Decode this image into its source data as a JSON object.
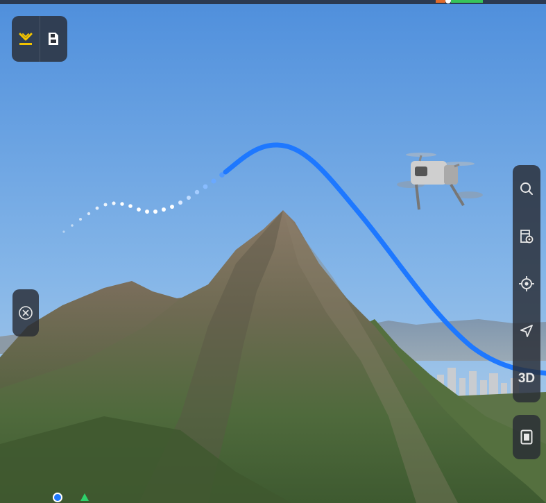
{
  "toolbar_top_left": {
    "items": [
      {
        "name": "landing-icon"
      },
      {
        "name": "save-icon"
      }
    ]
  },
  "left_panel": {
    "close_icon": "close-circle-icon"
  },
  "right_toolbar": {
    "items": [
      {
        "name": "search-icon"
      },
      {
        "name": "map-layers-icon"
      },
      {
        "name": "locate-target-icon"
      },
      {
        "name": "navigation-arrow-icon"
      },
      {
        "name": "3d-view-button",
        "label": "3D"
      }
    ],
    "extra_button": "map-view-icon"
  },
  "colors": {
    "accent": "#f2c300",
    "flight_path": "#1e78ff",
    "panel_bg": "#2c3038",
    "gps_blue": "#1e78ff",
    "gps_green": "#2ed06b"
  }
}
